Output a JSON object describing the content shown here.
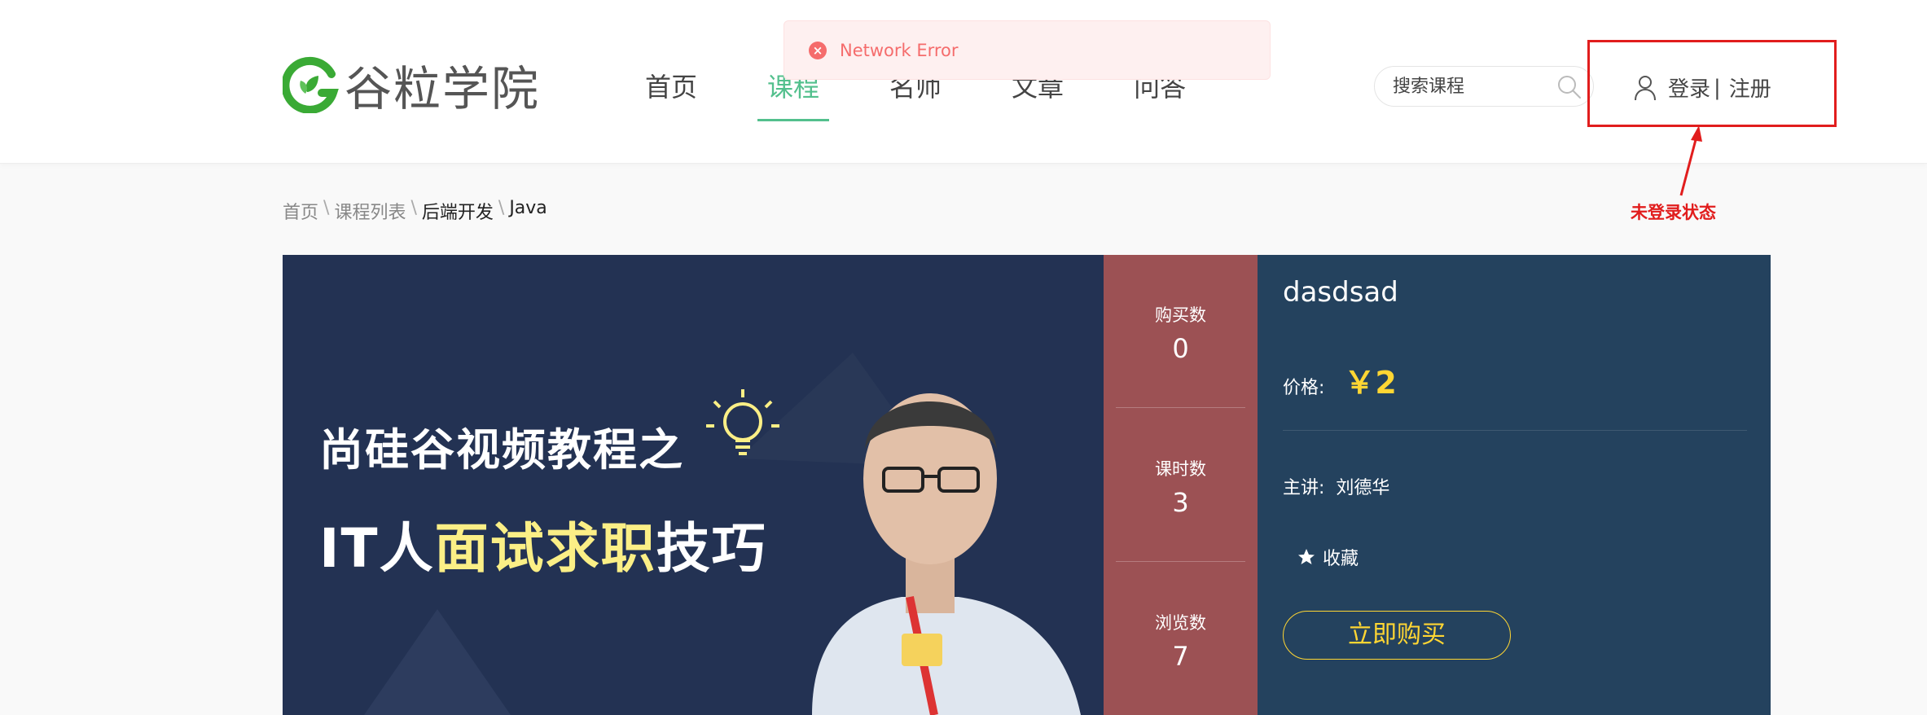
{
  "header": {
    "logo_text": "谷粒学院",
    "nav": [
      "首页",
      "课程",
      "名师",
      "文章",
      "问答"
    ],
    "active_nav": "课程",
    "search_placeholder": "搜索课程",
    "login_label": "登录",
    "separator": "|",
    "register_label": "注册"
  },
  "annotation": {
    "text": "未登录状态",
    "color": "#e11d1d"
  },
  "toast": {
    "text": "Network Error",
    "type": "error"
  },
  "breadcrumb": {
    "items": [
      "首页",
      "课程列表",
      "后端开发",
      "Java"
    ],
    "separator": "\\"
  },
  "banner": {
    "line1": "尚硅谷视频教程之",
    "line2_prefix": "IT人",
    "line2_highlight": "面试求职",
    "line2_suffix": "技巧"
  },
  "stats": [
    {
      "label": "购买数",
      "value": "0"
    },
    {
      "label": "课时数",
      "value": "3"
    },
    {
      "label": "浏览数",
      "value": "7"
    }
  ],
  "course": {
    "title": "dasdsad",
    "price_label": "价格:",
    "price": "￥2",
    "teacher_label": "主讲:",
    "teacher_name": "刘德华",
    "favorite_label": "收藏",
    "buy_label": "立即购买"
  },
  "colors": {
    "brand_green": "#53c08d",
    "stats_bg": "#9c5154",
    "info_bg": "#24425e",
    "banner_bg": "#233253",
    "price_yellow": "#ffd633",
    "error_red": "#f56c6c"
  }
}
